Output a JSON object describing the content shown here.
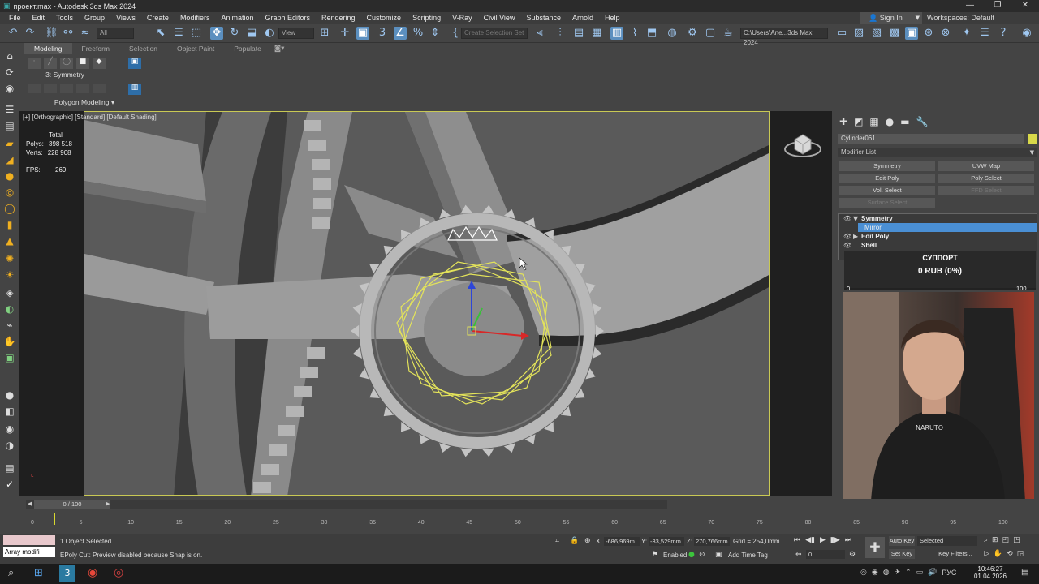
{
  "titlebar": {
    "title": "проект.max - Autodesk 3ds Max 2024",
    "minimize": "—",
    "restore": "❐",
    "close": "✕"
  },
  "menu": [
    "File",
    "Edit",
    "Tools",
    "Group",
    "Views",
    "Create",
    "Modifiers",
    "Animation",
    "Graph Editors",
    "Rendering",
    "Customize",
    "Scripting",
    "V-Ray",
    "Civil View",
    "Substance",
    "Arnold",
    "Help"
  ],
  "account": {
    "signin": "Sign In",
    "workspaces": "Workspaces: Default"
  },
  "toolbar": {
    "filter_value": "All",
    "refcoord_value": "View",
    "selection_set_placeholder": "Create Selection Set",
    "path_value": "C:\\Users\\Ane...3ds Max 2024"
  },
  "ribbon": {
    "tabs": [
      "Modeling",
      "Freeform",
      "Selection",
      "Object Paint",
      "Populate"
    ],
    "active_tab": "Modeling",
    "modifier_label": "3: Symmetry",
    "panel_label": "Polygon Modeling"
  },
  "viewport": {
    "label": "[+] [Orthographic] [Standard] [Default Shading]",
    "stats": {
      "total_label": "Total",
      "polys_label": "Polys:",
      "polys_value": "398 518",
      "verts_label": "Verts:",
      "verts_value": "228 908",
      "fps_label": "FPS:",
      "fps_value": "269"
    }
  },
  "command_panel": {
    "object_name": "Cylinder061",
    "object_color": "#d8d84a",
    "modifier_list": "Modifier List",
    "buttons": [
      {
        "label": "Symmetry",
        "enabled": true
      },
      {
        "label": "UVW Map",
        "enabled": true
      },
      {
        "label": "Edit Poly",
        "enabled": true
      },
      {
        "label": "Poly Select",
        "enabled": true
      },
      {
        "label": "Vol. Select",
        "enabled": true
      },
      {
        "label": "FFD Select",
        "enabled": false
      },
      {
        "label": "Surface Select",
        "enabled": false
      }
    ],
    "stack": [
      {
        "label": "Symmetry",
        "expanded": true
      },
      {
        "label": "Mirror",
        "selected": true
      },
      {
        "label": "Edit Poly",
        "expanded": false
      },
      {
        "label": "Shell",
        "expanded": false
      }
    ]
  },
  "donation": {
    "title": "СУППОРТ",
    "value": "0 RUB (0%)",
    "min": "0",
    "max": "100",
    "progress": 0
  },
  "timeline": {
    "frame_display": "0 / 100",
    "ticks": [
      "0",
      "5",
      "10",
      "15",
      "20",
      "25",
      "30",
      "35",
      "40",
      "45",
      "50",
      "55",
      "60",
      "65",
      "70",
      "75",
      "80",
      "85",
      "90",
      "95",
      "100"
    ]
  },
  "status": {
    "script_text": "Array modifi",
    "selection": "1 Object Selected",
    "prompt": "EPoly Cut: Preview disabled because Snap is on.",
    "x_label": "X:",
    "x_value": "-686,969m",
    "y_label": "Y:",
    "y_value": "-33,529mm",
    "z_label": "Z:",
    "z_value": "270,766mm",
    "grid": "Grid = 254,0mm",
    "enabled_label": "Enabled:",
    "add_time_tag": "Add Time Tag",
    "auto_key": "Auto Key",
    "set_key": "Set Key",
    "selected_value": "Selected",
    "key_filters": "Key Filters...",
    "frame_value": "0"
  },
  "taskbar": {
    "time": "10:46:27",
    "date": "01.04.2026",
    "lang": "РУС"
  }
}
